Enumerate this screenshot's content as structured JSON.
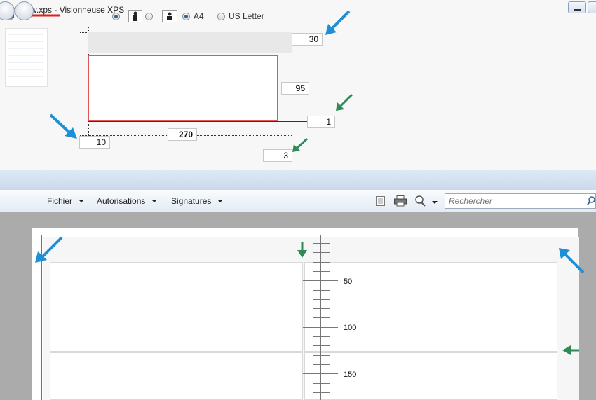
{
  "setup": {
    "paper_options": [
      "A4",
      "US Letter"
    ],
    "selected_paper": "A4",
    "orientation_selected": "portrait",
    "fields": {
      "top": "30",
      "right_width": "95",
      "spacing_v": "1",
      "left": "10",
      "width": "270",
      "spacing_h": "3"
    }
  },
  "viewer": {
    "title": "Preview.xps - Visionneuse XPS",
    "menus": [
      "Fichier",
      "Autorisations",
      "Signatures"
    ],
    "search_placeholder": "Rechercher",
    "ruler_labels": [
      "50",
      "100",
      "150"
    ]
  },
  "colors": {
    "red_arrow": "#e0201c",
    "blue_arrow": "#1d8fd6",
    "green_arrow": "#2e8b57",
    "margin_line": "#6b5fd3"
  }
}
